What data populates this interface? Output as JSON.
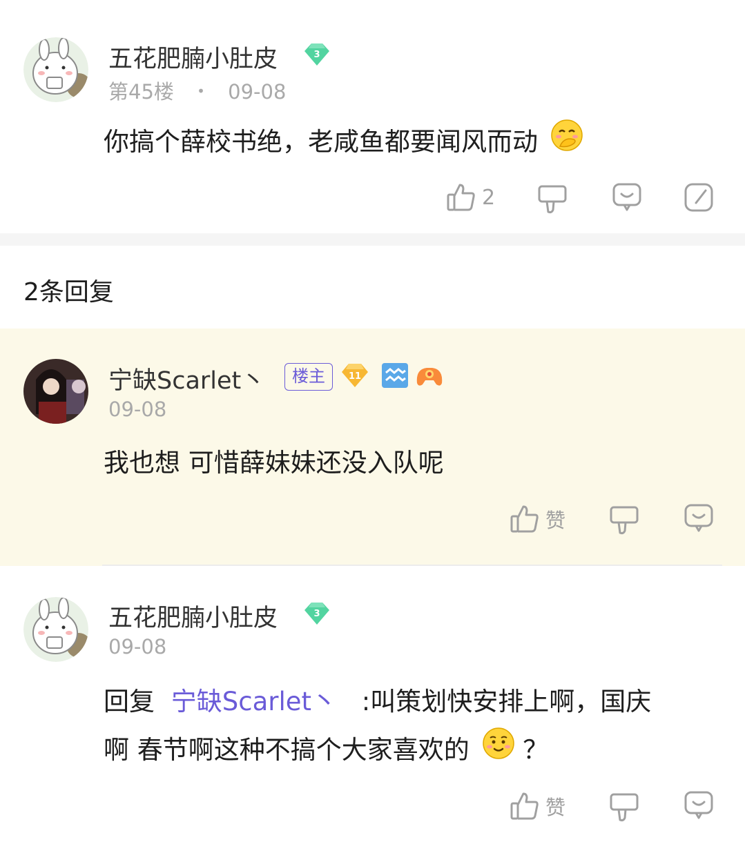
{
  "post": {
    "author": "五花肥腩小肚皮",
    "level_badge": "3",
    "floor": "第45楼",
    "separator": "•",
    "date": "09-08",
    "content": "你搞个薛校书绝，老咸鱼都要闻风而动",
    "emoji_name": "cover-mouth-emoji",
    "like_count": "2"
  },
  "replies_header": "2条回复",
  "reply1": {
    "author": "宁缺Scarlet丶",
    "op_badge": "楼主",
    "level_badge": "11",
    "date": "09-08",
    "content": "我也想 可惜薛妹妹还没入队呢",
    "like_label": "赞"
  },
  "reply2": {
    "author": "五花肥腩小肚皮",
    "level_badge": "3",
    "date": "09-08",
    "reply_prefix": "回复",
    "reply_to": "宁缺Scarlet丶",
    "content_line1": ":叫策划快安排上啊，国庆",
    "content_line2": "啊 春节啊这种不搞个大家喜欢的",
    "content_line2_suffix": "？",
    "emoji_name": "smile-emoji",
    "like_label": "赞"
  },
  "colors": {
    "highlight_bg": "#fcf9e8",
    "divider": "#f5f5f5",
    "link": "#6a5bd8",
    "gem_green": "#52d4a0",
    "gem_orange": "#f7b733",
    "muted": "#a9a9a9"
  }
}
